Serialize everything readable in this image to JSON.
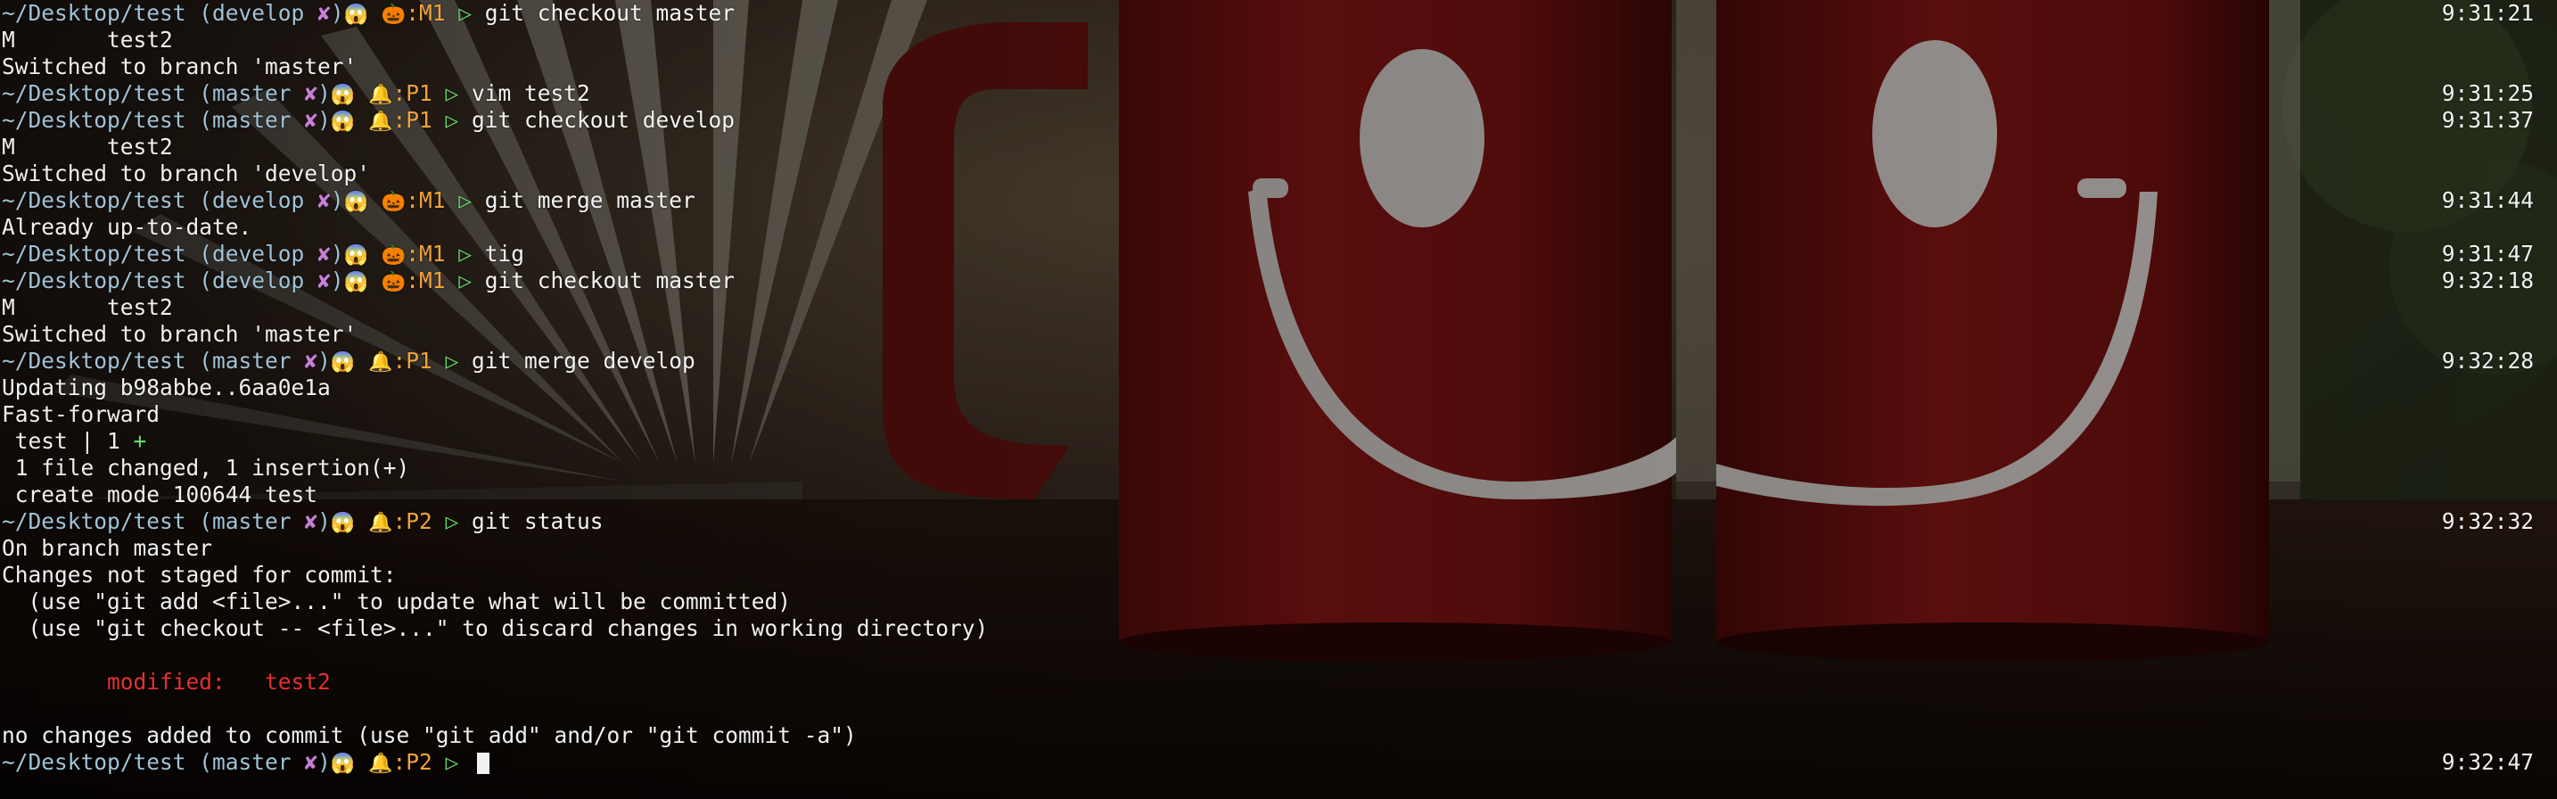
{
  "colors": {
    "path": "#9fc3d8",
    "dirty_mark": "#c87fd7",
    "status": "#f2a23a",
    "arrow": "#6ad96a",
    "modified": "#e5312f",
    "text": "#f1f1f1"
  },
  "icons": {
    "scream": "😱",
    "pumpkin": "🎃",
    "bell": "🔔",
    "dirty": "✘",
    "arrow": "▷"
  },
  "lines": [
    {
      "kind": "prompt",
      "path": "~/Desktop/test",
      "branch": "develop",
      "dirty": "✘",
      "emoji1": "😱",
      "emoji2": "🎃",
      "status": ":M1",
      "arrow": "▷",
      "cmd": "git checkout master",
      "time": "9:31:21"
    },
    {
      "kind": "out",
      "text": "M\ttest2"
    },
    {
      "kind": "out",
      "text": "Switched to branch 'master'"
    },
    {
      "kind": "prompt",
      "path": "~/Desktop/test",
      "branch": "master",
      "dirty": "✘",
      "emoji1": "😱",
      "emoji2": "🔔",
      "status": ":P1",
      "arrow": "▷",
      "cmd": "vim test2",
      "time": "9:31:25"
    },
    {
      "kind": "prompt",
      "path": "~/Desktop/test",
      "branch": "master",
      "dirty": "✘",
      "emoji1": "😱",
      "emoji2": "🔔",
      "status": ":P1",
      "arrow": "▷",
      "cmd": "git checkout develop",
      "time": "9:31:37"
    },
    {
      "kind": "out",
      "text": "M\ttest2"
    },
    {
      "kind": "out",
      "text": "Switched to branch 'develop'"
    },
    {
      "kind": "prompt",
      "path": "~/Desktop/test",
      "branch": "develop",
      "dirty": "✘",
      "emoji1": "😱",
      "emoji2": "🎃",
      "status": ":M1",
      "arrow": "▷",
      "cmd": "git merge master",
      "time": "9:31:44"
    },
    {
      "kind": "out",
      "text": "Already up-to-date."
    },
    {
      "kind": "prompt",
      "path": "~/Desktop/test",
      "branch": "develop",
      "dirty": "✘",
      "emoji1": "😱",
      "emoji2": "🎃",
      "status": ":M1",
      "arrow": "▷",
      "cmd": "tig",
      "time": "9:31:47"
    },
    {
      "kind": "prompt",
      "path": "~/Desktop/test",
      "branch": "develop",
      "dirty": "✘",
      "emoji1": "😱",
      "emoji2": "🎃",
      "status": ":M1",
      "arrow": "▷",
      "cmd": "git checkout master",
      "time": "9:32:18"
    },
    {
      "kind": "out",
      "text": "M\ttest2"
    },
    {
      "kind": "out",
      "text": "Switched to branch 'master'"
    },
    {
      "kind": "prompt",
      "path": "~/Desktop/test",
      "branch": "master",
      "dirty": "✘",
      "emoji1": "😱",
      "emoji2": "🔔",
      "status": ":P1",
      "arrow": "▷",
      "cmd": "git merge develop",
      "time": "9:32:28"
    },
    {
      "kind": "out",
      "text": "Updating b98abbe..6aa0e1a"
    },
    {
      "kind": "out",
      "text": "Fast-forward"
    },
    {
      "kind": "diffstat",
      "text": " test | 1 ",
      "plus": "+"
    },
    {
      "kind": "out",
      "text": " 1 file changed, 1 insertion(+)"
    },
    {
      "kind": "out",
      "text": " create mode 100644 test"
    },
    {
      "kind": "prompt",
      "path": "~/Desktop/test",
      "branch": "master",
      "dirty": "✘",
      "emoji1": "😱",
      "emoji2": "🔔",
      "status": ":P2",
      "arrow": "▷",
      "cmd": "git status",
      "time": "9:32:32"
    },
    {
      "kind": "out",
      "text": "On branch master"
    },
    {
      "kind": "out",
      "text": "Changes not staged for commit:"
    },
    {
      "kind": "out",
      "text": "  (use \"git add <file>...\" to update what will be committed)"
    },
    {
      "kind": "out",
      "text": "  (use \"git checkout -- <file>...\" to discard changes in working directory)"
    },
    {
      "kind": "blank",
      "text": ""
    },
    {
      "kind": "red",
      "text": "        modified:   test2"
    },
    {
      "kind": "blank",
      "text": ""
    },
    {
      "kind": "out",
      "text": "no changes added to commit (use \"git add\" and/or \"git commit -a\")"
    },
    {
      "kind": "prompt",
      "path": "~/Desktop/test",
      "branch": "master",
      "dirty": "✘",
      "emoji1": "😱",
      "emoji2": "🔔",
      "status": ":P2",
      "arrow": "▷",
      "cmd": "",
      "time": "9:32:47",
      "cursor": true
    }
  ]
}
